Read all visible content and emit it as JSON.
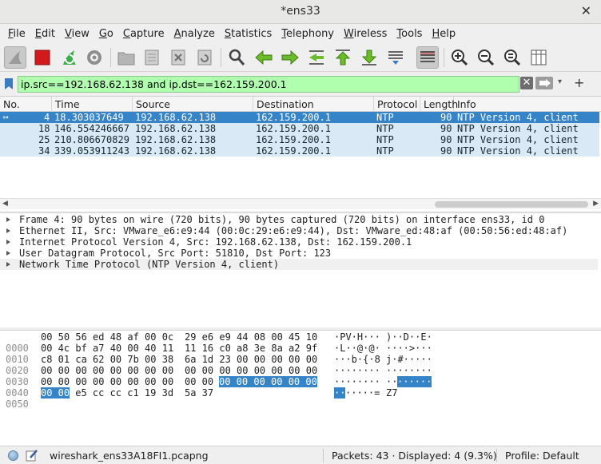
{
  "window": {
    "title": "*ens33",
    "close_glyph": "✕"
  },
  "menubar": [
    "File",
    "Edit",
    "View",
    "Go",
    "Capture",
    "Analyze",
    "Statistics",
    "Telephony",
    "Wireless",
    "Tools",
    "Help"
  ],
  "toolbar": {
    "icons": [
      "shark-fin-start-icon",
      "stop-capture-icon",
      "restart-capture-icon",
      "capture-options-icon",
      "open-file-icon",
      "save-file-icon",
      "close-file-icon",
      "reload-file-icon",
      "find-packet-icon",
      "go-back-icon",
      "go-forward-icon",
      "go-to-packet-icon",
      "go-first-packet-icon",
      "go-last-packet-icon",
      "auto-scroll-icon",
      "colorize-icon",
      "zoom-in-icon",
      "zoom-out-icon",
      "zoom-normal-icon",
      "resize-columns-icon"
    ]
  },
  "filter": {
    "value": "ip.src==192.168.62.138 and ip.dst==162.159.200.1",
    "clear_glyph": "✕",
    "dropdown_glyph": "▾",
    "add_glyph": "+"
  },
  "packet_list": {
    "columns": [
      "No.",
      "Time",
      "Source",
      "Destination",
      "Protocol",
      "Length",
      "Info"
    ],
    "rows": [
      {
        "no": "4",
        "time": "18.303037649",
        "source": "192.168.62.138",
        "destination": "162.159.200.1",
        "protocol": "NTP",
        "length": "90",
        "info": "NTP Version 4, client",
        "selected": true
      },
      {
        "no": "18",
        "time": "146.554246667",
        "source": "192.168.62.138",
        "destination": "162.159.200.1",
        "protocol": "NTP",
        "length": "90",
        "info": "NTP Version 4, client"
      },
      {
        "no": "25",
        "time": "210.806670829",
        "source": "192.168.62.138",
        "destination": "162.159.200.1",
        "protocol": "NTP",
        "length": "90",
        "info": "NTP Version 4, client"
      },
      {
        "no": "34",
        "time": "339.053911243",
        "source": "192.168.62.138",
        "destination": "162.159.200.1",
        "protocol": "NTP",
        "length": "90",
        "info": "NTP Version 4, client"
      }
    ],
    "scroll_left": "◀",
    "scroll_right": "▶"
  },
  "details": [
    "Frame 4: 90 bytes on wire (720 bits), 90 bytes captured (720 bits) on interface ens33, id 0",
    "Ethernet II, Src: VMware_e6:e9:44 (00:0c:29:e6:e9:44), Dst: VMware_ed:48:af (00:50:56:ed:48:af)",
    "Internet Protocol Version 4, Src: 192.168.62.138, Dst: 162.159.200.1",
    "User Datagram Protocol, Src Port: 51810, Dst Port: 123",
    "Network Time Protocol (NTP Version 4, client)"
  ],
  "bytes": [
    {
      "offset": "0000",
      "hex1": "00 50 56 ed 48 af 00 0c",
      "hex2": "29 e6 e9 44 08 00 45 10",
      "ascii1": "·PV·H···",
      "ascii2": ")··D··E·"
    },
    {
      "offset": "0010",
      "hex1": "00 4c bf a7 40 00 40 11",
      "hex2": "11 16 c0 a8 3e 8a a2 9f",
      "ascii1": "·L··@·@·",
      "ascii2": "····>···"
    },
    {
      "offset": "0020",
      "hex1": "c8 01 ca 62 00 7b 00 38",
      "hex2": "6a 1d 23 00 00 00 00 00",
      "ascii1": "···b·{·8",
      "ascii2": "j·#·····"
    },
    {
      "offset": "0030",
      "hex1": "00 00 00 00 00 00 00 00",
      "hex2": "00 00 00 00 00 00 00 00",
      "ascii1": "········",
      "ascii2": "········"
    },
    {
      "offset": "0040",
      "hex1": "00 00 00 00 00 00 00 00",
      "hex2_plain": "00 00 ",
      "hex2_hl": "00 00 00 00 00 00",
      "ascii1": "········",
      "ascii2_plain": "··",
      "ascii2_hl": "······"
    },
    {
      "offset": "0050",
      "hex1_hl": "00 00",
      "hex1_plain": " e5 cc cc c1 19 3d",
      "hex2": "5a 37",
      "ascii1_hl": "··",
      "ascii1_plain": "·····=",
      "ascii2": "Z7"
    }
  ],
  "status": {
    "file": "wireshark_ens33A18FI1.pcapng",
    "packets": "Packets: 43 · Displayed: 4 (9.3%)",
    "profile": "Profile: Default"
  }
}
